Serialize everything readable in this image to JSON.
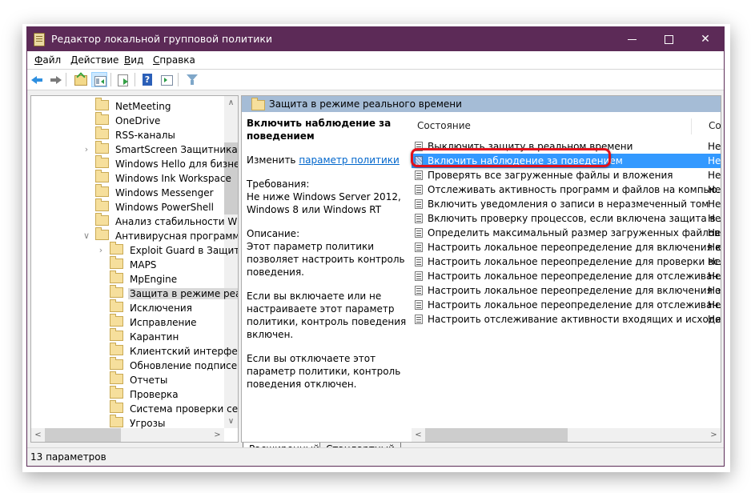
{
  "window": {
    "title": "Редактор локальной групповой политики",
    "controls": {
      "minimize": "minimize",
      "maximize": "maximize",
      "close": "✕"
    }
  },
  "menu": [
    {
      "label_ul": "Ф",
      "label_rest": "айл"
    },
    {
      "label_ul": "Д",
      "label_rest": "ействие"
    },
    {
      "label_ul": "В",
      "label_rest": "ид"
    },
    {
      "label_ul": "С",
      "label_rest": "правка"
    }
  ],
  "toolbar": [
    "back-icon",
    "forward-icon",
    "up-folder-icon",
    "show-hide-tree-icon",
    "export-list-icon",
    "help-icon",
    "show-hide-action-pane-icon",
    "filter-icon"
  ],
  "tree": {
    "items": [
      {
        "label": "NetMeeting",
        "level": 1,
        "expander": ""
      },
      {
        "label": "OneDrive",
        "level": 1,
        "expander": ""
      },
      {
        "label": "RSS-каналы",
        "level": 1,
        "expander": ""
      },
      {
        "label": "SmartScreen Защитника Windows",
        "level": 1,
        "expander": ">"
      },
      {
        "label": "Windows Hello для бизнеса",
        "level": 1,
        "expander": ""
      },
      {
        "label": "Windows Ink Workspace",
        "level": 1,
        "expander": ""
      },
      {
        "label": "Windows Messenger",
        "level": 1,
        "expander": ""
      },
      {
        "label": "Windows PowerShell",
        "level": 1,
        "expander": ""
      },
      {
        "label": "Анализ стабильности Windows",
        "level": 1,
        "expander": ""
      },
      {
        "label": "Антивирусная программа",
        "level": 1,
        "expander": "v"
      },
      {
        "label": "Exploit Guard в Защитнике",
        "level": 2,
        "expander": ">"
      },
      {
        "label": "MAPS",
        "level": 2,
        "expander": ""
      },
      {
        "label": "MpEngine",
        "level": 2,
        "expander": ""
      },
      {
        "label": "Защита в режиме реального времени",
        "level": 2,
        "expander": "",
        "selected": true
      },
      {
        "label": "Исключения",
        "level": 2,
        "expander": ""
      },
      {
        "label": "Исправление",
        "level": 2,
        "expander": ""
      },
      {
        "label": "Карантин",
        "level": 2,
        "expander": ""
      },
      {
        "label": "Клиентский интерфейс",
        "level": 2,
        "expander": ""
      },
      {
        "label": "Обновление подписей",
        "level": 2,
        "expander": ""
      },
      {
        "label": "Отчеты",
        "level": 2,
        "expander": ""
      },
      {
        "label": "Проверка",
        "level": 2,
        "expander": ""
      },
      {
        "label": "Система проверки сети",
        "level": 2,
        "expander": ""
      },
      {
        "label": "Угрозы",
        "level": 2,
        "expander": ""
      }
    ]
  },
  "right": {
    "header_title": "Защита в режиме реального времени",
    "description": {
      "title": "Включить наблюдение за поведением",
      "edit_prefix": "Изменить ",
      "edit_link": "параметр политики",
      "requirements_label": "Требования:",
      "requirements": "Не ниже Windows Server 2012, Windows 8 или Windows RT",
      "description_label": "Описание:",
      "description": "Этот параметр политики позволяет настроить контроль поведения.",
      "if_enabled": "Если вы включаете или не настраиваете этот параметр политики, контроль поведения включен.",
      "if_disabled": "Если вы отключаете этот параметр политики, контроль поведения отключен."
    },
    "columns": [
      "Состояние",
      "Со"
    ],
    "rows": [
      {
        "name": "Выключить защиту в реальном времени",
        "state": "Не"
      },
      {
        "name": "Включить наблюдение за поведением",
        "state": "Не",
        "selected": true
      },
      {
        "name": "Проверять все загруженные файлы и вложения",
        "state": "Не"
      },
      {
        "name": "Отслеживать активность программ и файлов на компью...",
        "state": "Не"
      },
      {
        "name": "Включить уведомления о записи в неразмеченный том",
        "state": "Не"
      },
      {
        "name": "Включить проверку процессов, если включена защита в ...",
        "state": "Не"
      },
      {
        "name": "Определить максимальный размер загруженных файлов...",
        "state": "Не"
      },
      {
        "name": "Настроить локальное переопределение для включения к...",
        "state": "Не"
      },
      {
        "name": "Настроить локальное переопределение для проверки вс...",
        "state": "Не"
      },
      {
        "name": "Настроить локальное переопределение для отслеживан...",
        "state": "Не"
      },
      {
        "name": "Настроить локальное переопределение для включения з...",
        "state": "Не"
      },
      {
        "name": "Настроить локальное переопределение для отслеживан...",
        "state": "Не"
      },
      {
        "name": "Настроить отслеживание активности входящих и исходя...",
        "state": "Не"
      }
    ],
    "highlight_color": "#e0121c"
  },
  "tabs": [
    {
      "label": "Расширенный",
      "active": true
    },
    {
      "label": "Стандартный",
      "active": false
    }
  ],
  "status": {
    "text": "13 параметров"
  },
  "colors": {
    "titlebar": "#5c2a57",
    "selection": "#3399ff",
    "header": "#a5bcd6"
  }
}
